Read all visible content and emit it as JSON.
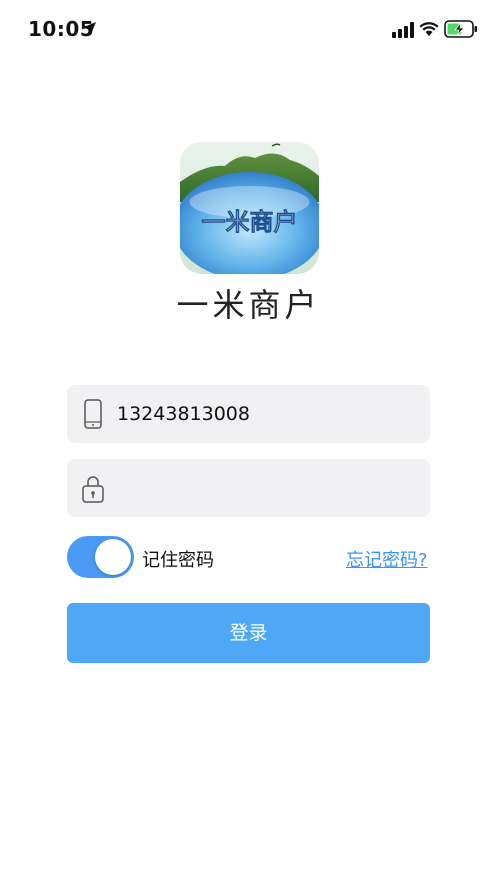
{
  "status_bar": {
    "time": "10:05",
    "icons": [
      "location-arrow-icon",
      "signal-icon",
      "wifi-icon",
      "battery-charging-icon"
    ]
  },
  "logo": {
    "text": "一米商户"
  },
  "brand": {
    "name": "一米商户"
  },
  "form": {
    "phone": {
      "value": "13243813008",
      "icon": "phone-icon"
    },
    "password": {
      "value": "",
      "icon": "lock-icon"
    },
    "remember": {
      "label": "记住密码",
      "checked": true
    },
    "forgot_label": "忘记密码?",
    "login_label": "登录"
  },
  "colors": {
    "accent": "#4a9bf5",
    "button": "#4fa8f5",
    "link": "#3d95ee",
    "field_bg": "#f1f1f4"
  }
}
